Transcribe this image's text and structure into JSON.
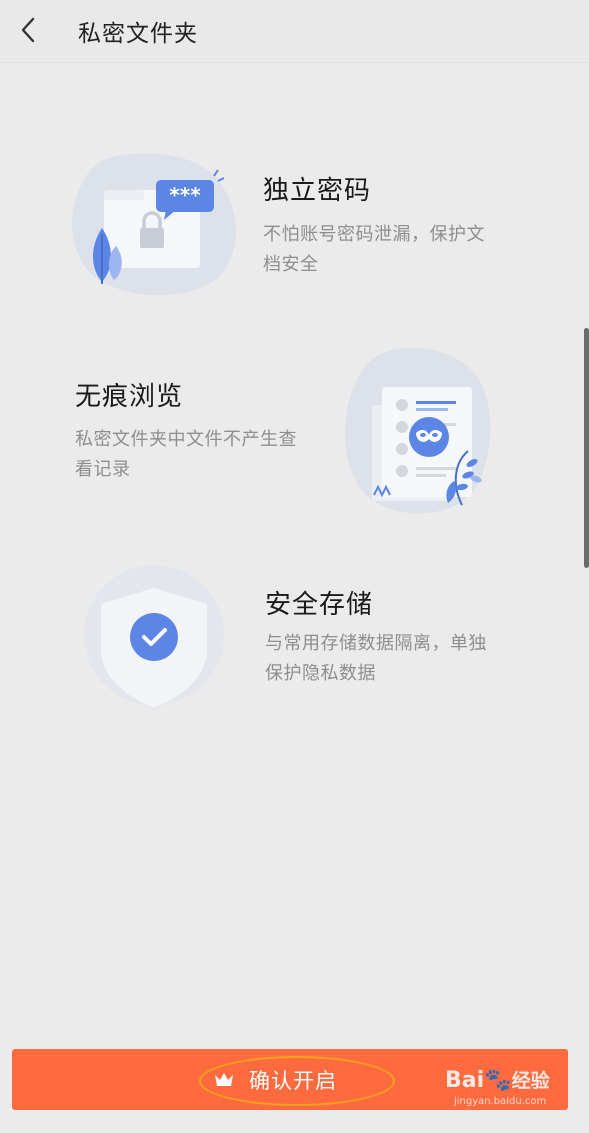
{
  "header": {
    "title": "私密文件夹",
    "back_icon": "chevron-left-icon"
  },
  "features": [
    {
      "title": "独立密码",
      "desc": "不怕账号密码泄漏，保护文档安全",
      "icon": "folder-lock-illustration"
    },
    {
      "title": "无痕浏览",
      "desc": "私密文件夹中文件不产生查看记录",
      "icon": "mask-document-illustration"
    },
    {
      "title": "安全存储",
      "desc": "与常用存储数据隔离，单独保护隐私数据",
      "icon": "shield-check-illustration"
    }
  ],
  "footer": {
    "confirm_label": "确认开启",
    "crown_icon": "crown-icon"
  },
  "watermark": {
    "brand": "Bai",
    "brand2": "经验",
    "url": "jingyan.baidu.com"
  },
  "colors": {
    "accent": "#ff6a3f",
    "illustration_blue": "#5b86e5",
    "annotation": "#f2a21b"
  }
}
